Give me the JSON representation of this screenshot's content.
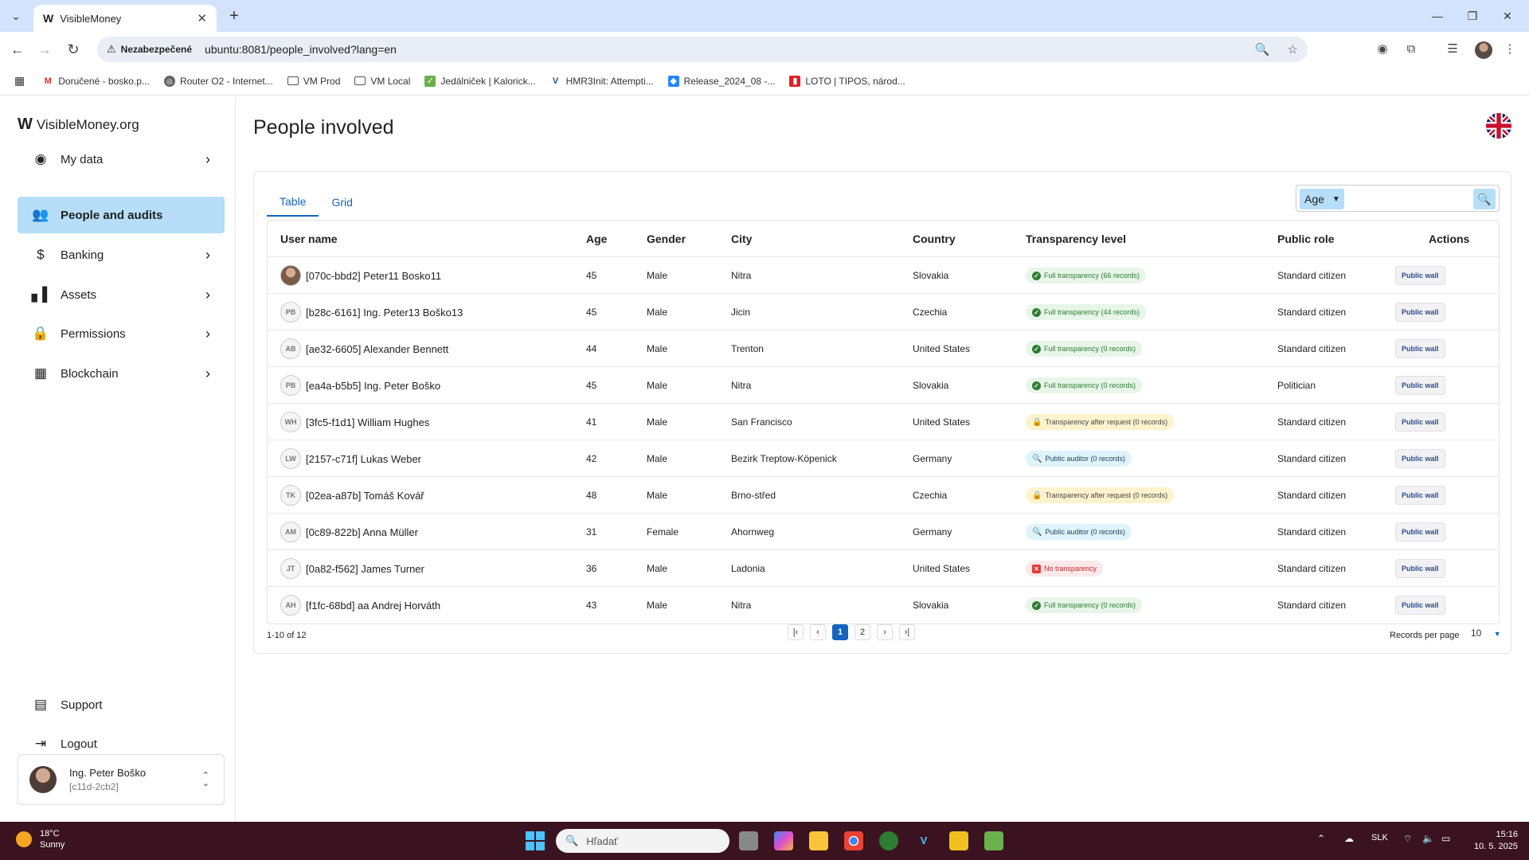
{
  "browser": {
    "tab_title": "VisibleMoney",
    "security_label": "Nezabezpečené",
    "url": "ubuntu:8081/people_involved?lang=en",
    "bookmarks": [
      {
        "label": "Doručené - bosko.p...",
        "icon": "gmail-icon"
      },
      {
        "label": "Router O2 - Internet...",
        "icon": "globe-icon"
      },
      {
        "label": "VM Prod",
        "icon": "folder-icon"
      },
      {
        "label": "VM Local",
        "icon": "folder-icon"
      },
      {
        "label": "Jedálniček | Kalorick...",
        "icon": "kaloricke-icon"
      },
      {
        "label": "HMR3Init: Attempti...",
        "icon": "virtualbox-icon"
      },
      {
        "label": "Release_2024_08 -...",
        "icon": "jira-icon"
      },
      {
        "label": "LOTO | TIPOS, národ...",
        "icon": "tipos-icon"
      }
    ]
  },
  "sidebar": {
    "brand": "VisibleMoney.org",
    "items": [
      {
        "label": "My data",
        "icon": "account-circle-icon",
        "has_chevron": true
      },
      {
        "label": "People and audits",
        "icon": "people-icon",
        "active": true
      },
      {
        "label": "Banking",
        "icon": "banking-icon",
        "has_chevron": true
      },
      {
        "label": "Assets",
        "icon": "bar-chart-icon",
        "has_chevron": true
      },
      {
        "label": "Permissions",
        "icon": "lock-icon",
        "has_chevron": true
      },
      {
        "label": "Blockchain",
        "icon": "blocks-icon",
        "has_chevron": true
      }
    ],
    "support": "Support",
    "logout": "Logout",
    "user": {
      "name": "Ing. Peter Boško",
      "id": "[c11d-2cb2]"
    }
  },
  "main": {
    "title": "People involved",
    "tabs": [
      "Table",
      "Grid"
    ],
    "active_tab": "Table",
    "search": {
      "filter": "Age",
      "value": ""
    },
    "columns": [
      "User name",
      "Age",
      "Gender",
      "City",
      "Country",
      "Transparency level",
      "Public role",
      "Actions"
    ],
    "rows": [
      {
        "initials": "",
        "photo": true,
        "name": "[070c-bbd2] Peter11 Bosko11",
        "age": "45",
        "gender": "Male",
        "city": "Nitra",
        "country": "Slovakia",
        "transparency": "Full transparency (66 records)",
        "level": "full",
        "role": "Standard citizen",
        "action": "Public wall"
      },
      {
        "initials": "PB",
        "name": "[b28c-6161] Ing. Peter13 Boško13",
        "age": "45",
        "gender": "Male",
        "city": "Jicin",
        "country": "Czechia",
        "transparency": "Full transparency (44 records)",
        "level": "full",
        "role": "Standard citizen",
        "action": "Public wall"
      },
      {
        "initials": "AB",
        "name": "[ae32-6605] Alexander Bennett",
        "age": "44",
        "gender": "Male",
        "city": "Trenton",
        "country": "United States",
        "transparency": "Full transparency (0 records)",
        "level": "full",
        "role": "Standard citizen",
        "action": "Public wall"
      },
      {
        "initials": "PB",
        "name": "[ea4a-b5b5] Ing. Peter Boško",
        "age": "45",
        "gender": "Male",
        "city": "Nitra",
        "country": "Slovakia",
        "transparency": "Full transparency (0 records)",
        "level": "full",
        "role": "Politician",
        "action": "Public wall"
      },
      {
        "initials": "WH",
        "name": "[3fc5-f1d1] William Hughes",
        "age": "41",
        "gender": "Male",
        "city": "San Francisco",
        "country": "United States",
        "transparency": "Transparency after request (0 records)",
        "level": "request",
        "role": "Standard citizen",
        "action": "Public wall"
      },
      {
        "initials": "LW",
        "name": "[2157-c71f] Lukas Weber",
        "age": "42",
        "gender": "Male",
        "city": "Bezirk Treptow-Köpenick",
        "country": "Germany",
        "transparency": "Public auditor (0 records)",
        "level": "auditor",
        "role": "Standard citizen",
        "action": "Public wall"
      },
      {
        "initials": "TK",
        "name": "[02ea-a87b] Tomáš Kovář",
        "age": "48",
        "gender": "Male",
        "city": "Brno-střed",
        "country": "Czechia",
        "transparency": "Transparency after request (0 records)",
        "level": "request",
        "role": "Standard citizen",
        "action": "Public wall"
      },
      {
        "initials": "AM",
        "name": "[0c89-822b] Anna Müller",
        "age": "31",
        "gender": "Female",
        "city": "Ahornweg",
        "country": "Germany",
        "transparency": "Public auditor (0 records)",
        "level": "auditor",
        "role": "Standard citizen",
        "action": "Public wall"
      },
      {
        "initials": "JT",
        "name": "[0a82-f562] James Turner",
        "age": "36",
        "gender": "Male",
        "city": "Ladonia",
        "country": "United States",
        "transparency": "No transparency",
        "level": "none",
        "role": "Standard citizen",
        "action": "Public wall"
      },
      {
        "initials": "AH",
        "name": "[f1fc-68bd] aa Andrej Horváth",
        "age": "43",
        "gender": "Male",
        "city": "Nitra",
        "country": "Slovakia",
        "transparency": "Full transparency (0 records)",
        "level": "full",
        "role": "Standard citizen",
        "action": "Public wall"
      }
    ],
    "pagination": {
      "range": "1-10 of 12",
      "pages": [
        "1",
        "2"
      ],
      "current": "1",
      "records_label": "Records per page",
      "records_value": "10"
    }
  },
  "taskbar": {
    "weather_temp": "18°C",
    "weather_desc": "Sunny",
    "search_placeholder": "Hľadať",
    "language": "SLK",
    "time": "15:16",
    "date": "10. 5. 2025"
  }
}
